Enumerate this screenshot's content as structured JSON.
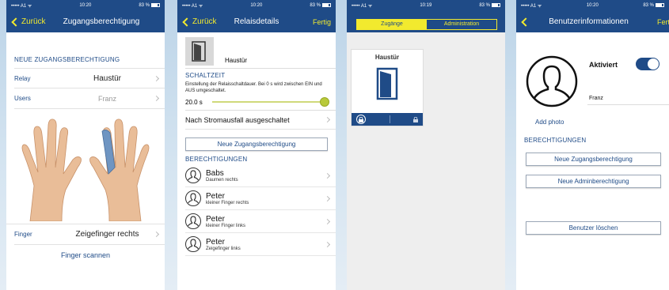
{
  "colors": {
    "navy": "#1f4b87",
    "accent": "#f2ea2e",
    "slider": "#b8c93a"
  },
  "screen1": {
    "status": {
      "left": "••••• A1 ᯤ",
      "time": "10:20",
      "battery": "83 %"
    },
    "back_label": "Zurück",
    "title": "Zugangsberechtigung",
    "section": "NEUE ZUGANGSBERECHTIGUNG",
    "rows": [
      {
        "label": "Relay",
        "value": "Haustür"
      },
      {
        "label": "Users",
        "value": "Franz"
      }
    ],
    "finger_label": "Finger",
    "finger_value": "Zeigefinger rechts",
    "scan_label": "Finger scannen"
  },
  "screen2": {
    "status": {
      "left": "••••• A1 ᯤ",
      "time": "10:20",
      "battery": "83 %"
    },
    "back_label": "Zurück",
    "title": "Relaisdetails",
    "done_label": "Fertig",
    "relay_name": "Haustür",
    "section_time": "SCHALTZEIT",
    "time_desc": "Einstellung der Relaisschaltdauer. Bei 0 s wird zwischen EIN und AUS umgeschaltet.",
    "time_value": "20.0 s",
    "slider_fraction": 1.0,
    "power_fail_label": "Nach Stromausfall ausgeschaltet",
    "new_access_btn": "Neue Zugangsberechtigung",
    "section_perms": "BERECHTIGUNGEN",
    "permissions": [
      {
        "name": "Babs",
        "finger": "Daumen rechts"
      },
      {
        "name": "Peter",
        "finger": "kleiner Finger rechts"
      },
      {
        "name": "Peter",
        "finger": "kleiner Finger links"
      },
      {
        "name": "Peter",
        "finger": "Zeigefinger links"
      }
    ]
  },
  "screen3": {
    "status": {
      "left": "••••• A1 ᯤ",
      "time": "10:19",
      "battery": "83 %"
    },
    "tab_active": "Zugänge",
    "tab_inactive": "Administration",
    "tile_label": "Haustür"
  },
  "screen4": {
    "status": {
      "left": "••••• A1 ᯤ",
      "time": "10:20",
      "battery": "83 %"
    },
    "title": "Benutzerinformationen",
    "done_label": "Fertig",
    "activated_label": "Aktiviert",
    "activated": true,
    "user_name": "Franz",
    "add_photo": "Add photo",
    "section_perms": "BERECHTIGUNGEN",
    "btn_new_access": "Neue Zugangsberechtigung",
    "btn_new_admin": "Neue Adminberechtigung",
    "btn_delete": "Benutzer löschen"
  }
}
